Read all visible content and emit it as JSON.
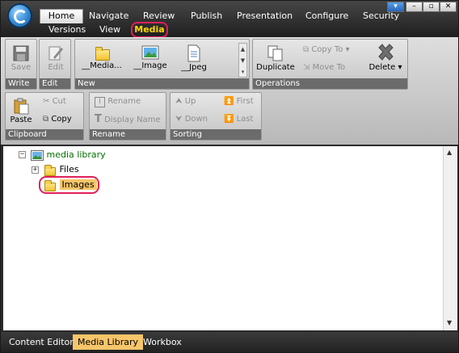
{
  "tabs": {
    "row1": [
      "Home",
      "Navigate",
      "Review",
      "Publish",
      "Presentation",
      "Configure",
      "Security"
    ],
    "row2": [
      "Versions",
      "View",
      "Media"
    ],
    "active": "Home",
    "highlighted": "Media"
  },
  "window_buttons": {
    "minimize": "–",
    "restore": "▫",
    "close": "✕",
    "dropdown": "▾"
  },
  "ribbon": {
    "write": {
      "label": "Write",
      "save": "Save"
    },
    "edit": {
      "label": "Edit",
      "edit": "Edit"
    },
    "new": {
      "label": "New",
      "media": "__Media...",
      "image": "__Image",
      "jpeg": "__Jpeg"
    },
    "operations": {
      "label": "Operations",
      "duplicate": "Duplicate",
      "copy_to": "Copy To",
      "move_to": "Move To",
      "delete": "Delete"
    },
    "clipboard": {
      "label": "Clipboard",
      "paste": "Paste",
      "cut": "Cut",
      "copy": "Copy"
    },
    "rename": {
      "label": "Rename",
      "rename": "Rename",
      "display_name": "Display Name"
    },
    "sorting": {
      "label": "Sorting",
      "up": "Up",
      "first": "First",
      "down": "Down",
      "last": "Last"
    }
  },
  "tree": {
    "root": "media library",
    "children": [
      {
        "label": "Files",
        "expander": "+"
      },
      {
        "label": "Images",
        "selected": true
      }
    ],
    "root_expander": "−"
  },
  "bottom_tabs": [
    "Content Editor",
    "Media Library",
    "Workbox"
  ],
  "active_bottom_tab": "Media Library",
  "colors": {
    "highlight_ring": "#e0205a",
    "media_tab_text": "#ffd700",
    "selection": "#f7c56a"
  }
}
